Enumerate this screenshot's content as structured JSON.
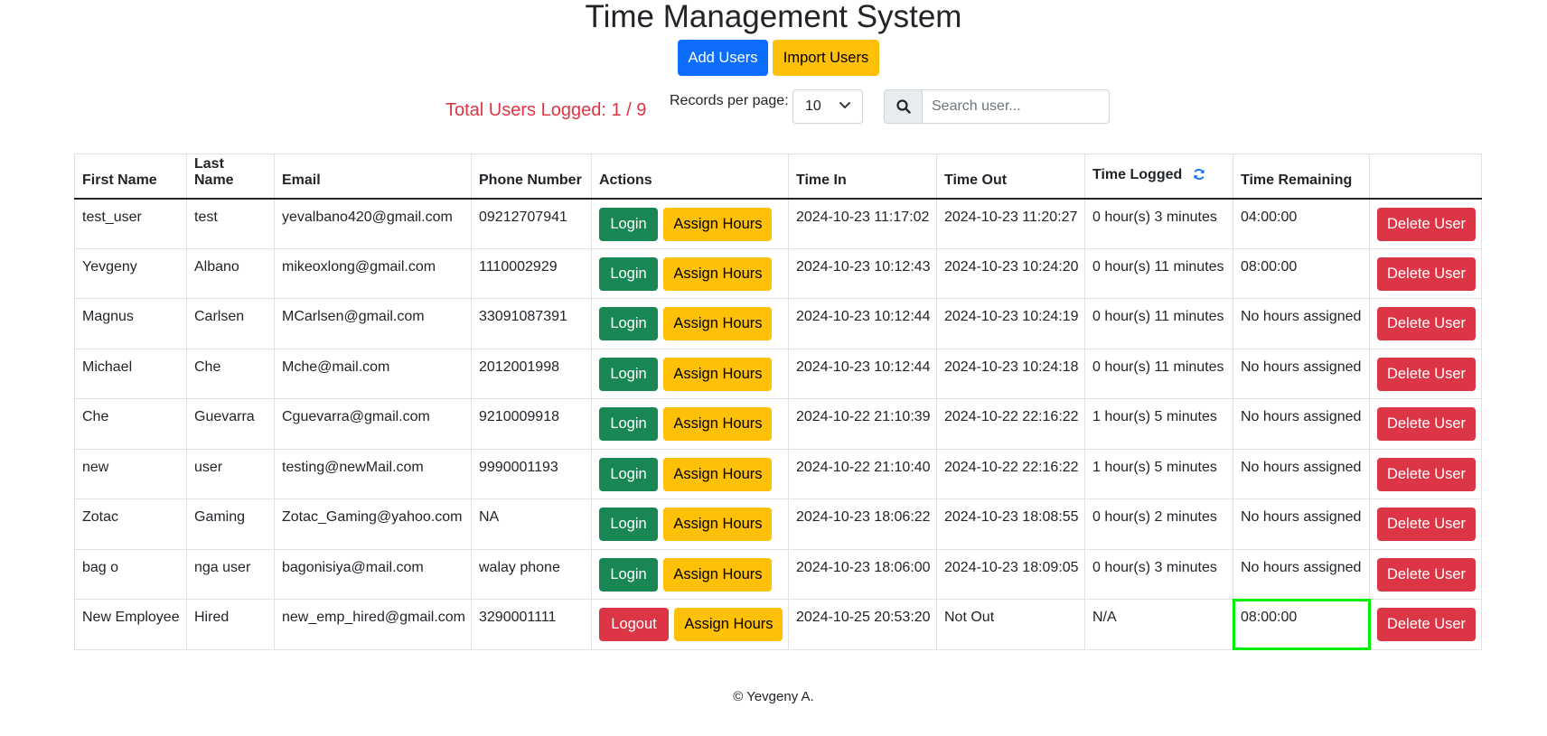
{
  "header": {
    "title": "Time Management System",
    "add_users_label": "Add Users",
    "import_users_label": "Import Users"
  },
  "controls": {
    "total_logged": "Total Users Logged: 1 / 9",
    "records_label": "Records per page:",
    "records_value": "10",
    "search_placeholder": "Search user..."
  },
  "table": {
    "headers": {
      "first_name": "First Name",
      "last_name": "Last Name",
      "email": "Email",
      "phone": "Phone Number",
      "actions": "Actions",
      "time_in": "Time In",
      "time_out": "Time Out",
      "time_logged": "Time Logged",
      "time_remaining": "Time Remaining"
    },
    "rows": [
      {
        "first": "test_user",
        "last": "test",
        "email": "yevalbano420@gmail.com",
        "phone": "09212707941",
        "action": "Login",
        "assign": "Assign Hours",
        "time_in": "2024-10-23 11:17:02",
        "time_out": "2024-10-23 11:20:27",
        "logged": "0 hour(s) 3 minutes",
        "remaining": "04:00:00",
        "delete": "Delete User"
      },
      {
        "first": "Yevgeny",
        "last": "Albano",
        "email": "mikeoxlong@gmail.com",
        "phone": "1110002929",
        "action": "Login",
        "assign": "Assign Hours",
        "time_in": "2024-10-23 10:12:43",
        "time_out": "2024-10-23 10:24:20",
        "logged": "0 hour(s) 11 minutes",
        "remaining": "08:00:00",
        "delete": "Delete User"
      },
      {
        "first": "Magnus",
        "last": "Carlsen",
        "email": "MCarlsen@gmail.com",
        "phone": "33091087391",
        "action": "Login",
        "assign": "Assign Hours",
        "time_in": "2024-10-23 10:12:44",
        "time_out": "2024-10-23 10:24:19",
        "logged": "0 hour(s) 11 minutes",
        "remaining": "No hours assigned",
        "delete": "Delete User"
      },
      {
        "first": "Michael",
        "last": "Che",
        "email": "Mche@mail.com",
        "phone": "2012001998",
        "action": "Login",
        "assign": "Assign Hours",
        "time_in": "2024-10-23 10:12:44",
        "time_out": "2024-10-23 10:24:18",
        "logged": "0 hour(s) 11 minutes",
        "remaining": "No hours assigned",
        "delete": "Delete User"
      },
      {
        "first": "Che",
        "last": "Guevarra",
        "email": "Cguevarra@gmail.com",
        "phone": "9210009918",
        "action": "Login",
        "assign": "Assign Hours",
        "time_in": "2024-10-22 21:10:39",
        "time_out": "2024-10-22 22:16:22",
        "logged": "1 hour(s) 5 minutes",
        "remaining": "No hours assigned",
        "delete": "Delete User"
      },
      {
        "first": "new",
        "last": "user",
        "email": "testing@newMail.com",
        "phone": "9990001193",
        "action": "Login",
        "assign": "Assign Hours",
        "time_in": "2024-10-22 21:10:40",
        "time_out": "2024-10-22 22:16:22",
        "logged": "1 hour(s) 5 minutes",
        "remaining": "No hours assigned",
        "delete": "Delete User"
      },
      {
        "first": "Zotac",
        "last": "Gaming",
        "email": "Zotac_Gaming@yahoo.com",
        "phone": "NA",
        "action": "Login",
        "assign": "Assign Hours",
        "time_in": "2024-10-23 18:06:22",
        "time_out": "2024-10-23 18:08:55",
        "logged": "0 hour(s) 2 minutes",
        "remaining": "No hours assigned",
        "delete": "Delete User"
      },
      {
        "first": "bag o",
        "last": "nga user",
        "email": "bagonisiya@mail.com",
        "phone": "walay phone",
        "action": "Login",
        "assign": "Assign Hours",
        "time_in": "2024-10-23 18:06:00",
        "time_out": "2024-10-23 18:09:05",
        "logged": "0 hour(s) 3 minutes",
        "remaining": "No hours assigned",
        "delete": "Delete User"
      },
      {
        "first": "New Employee",
        "last": "Hired",
        "email": "new_emp_hired@gmail.com",
        "phone": "3290001111",
        "action": "Logout",
        "assign": "Assign Hours",
        "time_in": "2024-10-25 20:53:20",
        "time_out": "Not Out",
        "logged": "N/A",
        "remaining": "08:00:00",
        "delete": "Delete User",
        "highlight_remaining": true
      }
    ]
  },
  "footer": {
    "text": "© Yevgeny A."
  },
  "icons": {
    "search": "search-icon",
    "chevron": "chevron-down-icon",
    "refresh": "refresh-icon"
  },
  "colors": {
    "primary": "#0d6efd",
    "warning": "#ffc107",
    "success": "#198754",
    "danger": "#dc3545",
    "highlight": "#00ee00"
  }
}
